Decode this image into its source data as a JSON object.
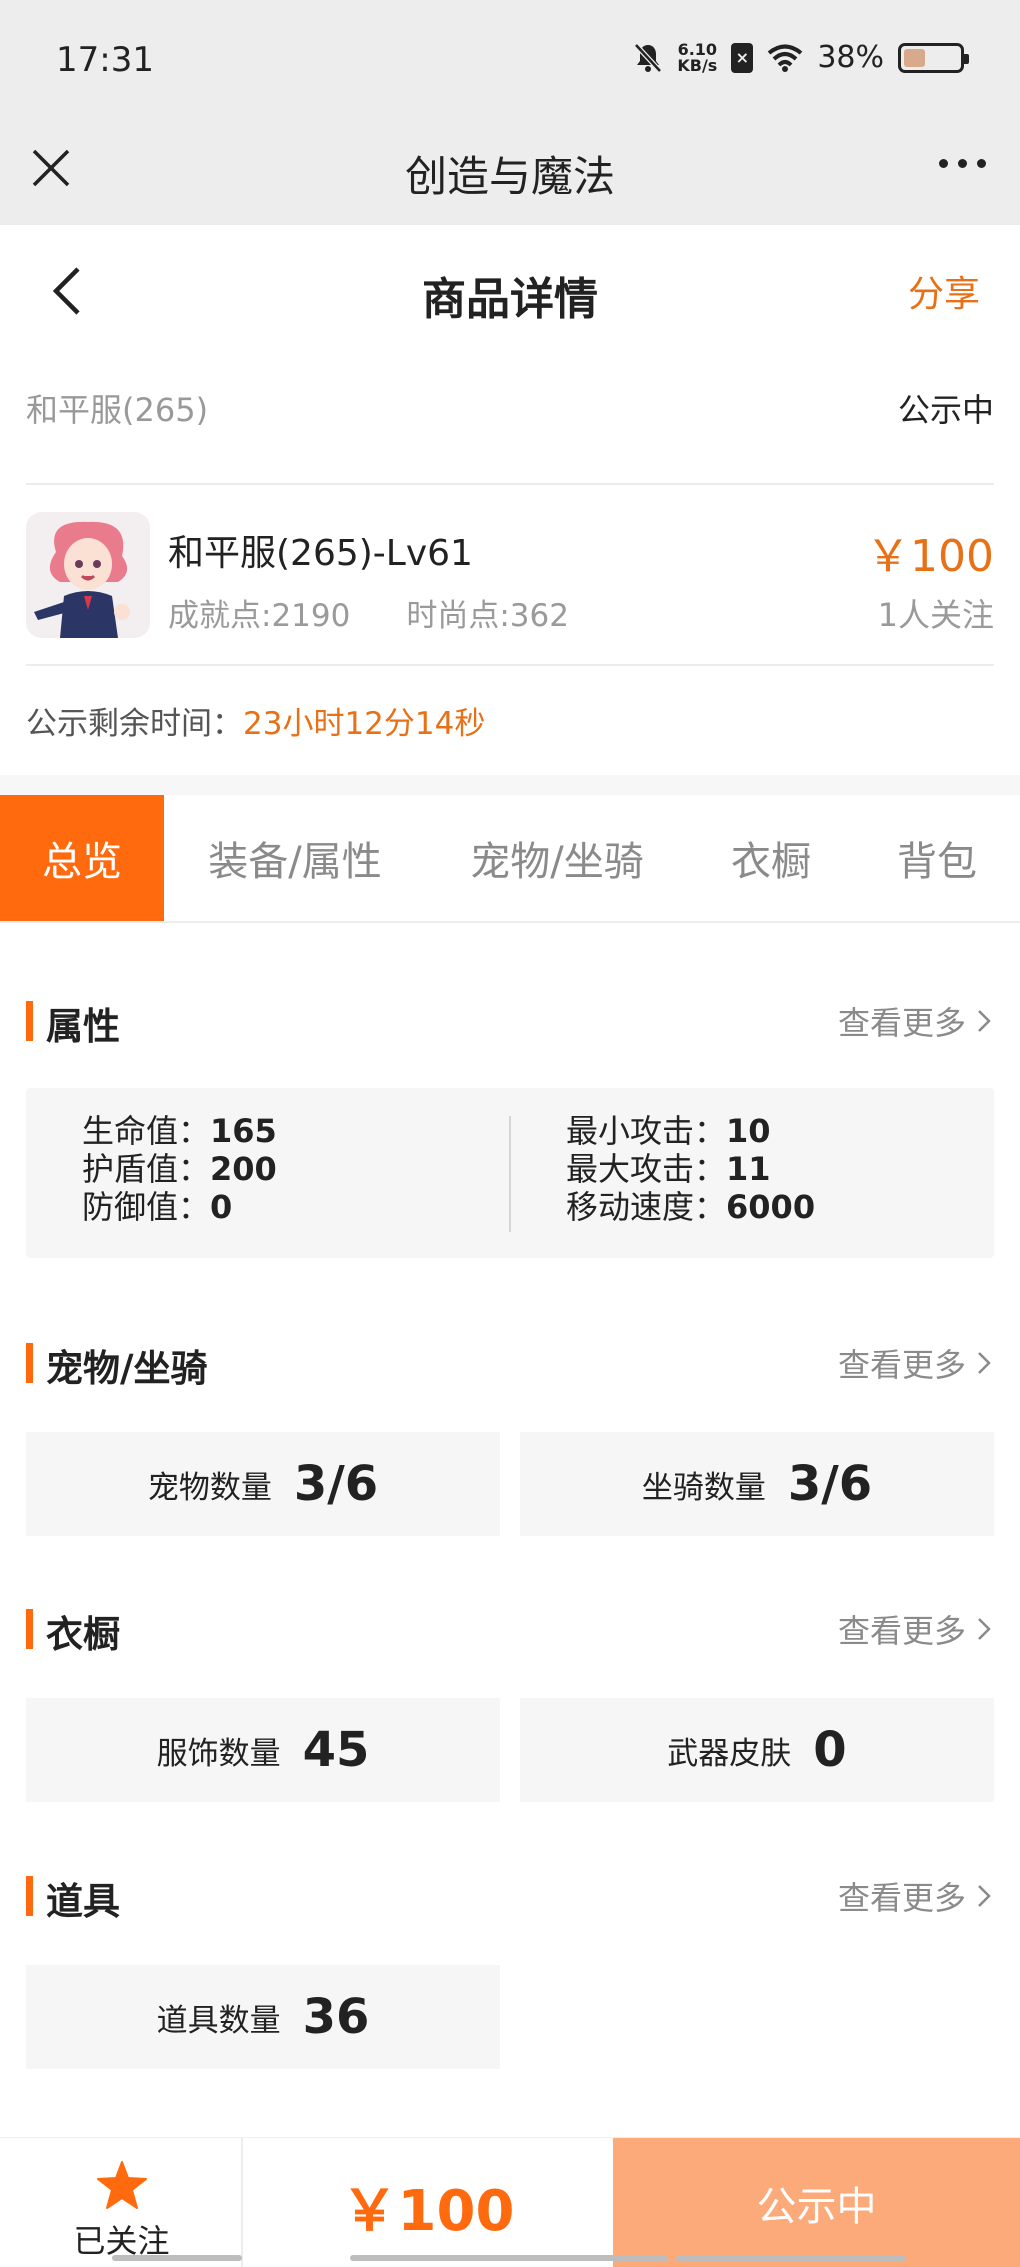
{
  "status_bar": {
    "time": "17:31",
    "net_speed_value": "6.10",
    "net_speed_unit": "KB/s",
    "battery": "38%",
    "battery_level": 0.38
  },
  "app_bar": {
    "title": "创造与魔法"
  },
  "header": {
    "title": "商品详情",
    "share_label": "分享"
  },
  "listing": {
    "server": "和平服(265)",
    "status": "公示中",
    "name": "和平服(265)-Lv61",
    "achievement": "成就点:2190",
    "fashion": "时尚点:362",
    "price": "￥100",
    "followers": "1人关注",
    "remain_label": "公示剩余时间：",
    "remain_value": "23小时12分14秒"
  },
  "tabs": [
    {
      "label": "总览",
      "active": true
    },
    {
      "label": "装备/属性",
      "active": false
    },
    {
      "label": "宠物/坐骑",
      "active": false
    },
    {
      "label": "衣橱",
      "active": false
    },
    {
      "label": "背包",
      "active": false
    }
  ],
  "more_label": "查看更多",
  "attributes": {
    "title": "属性",
    "left": [
      {
        "label": "生命值：",
        "value": "165"
      },
      {
        "label": "护盾值：",
        "value": "200"
      },
      {
        "label": "防御值：",
        "value": "0"
      }
    ],
    "right": [
      {
        "label": "最小攻击：",
        "value": "10"
      },
      {
        "label": "最大攻击：",
        "value": "11"
      },
      {
        "label": "移动速度：",
        "value": "6000"
      }
    ]
  },
  "pets": {
    "title": "宠物/坐骑",
    "cards": [
      {
        "label": "宠物数量",
        "value": "3/6"
      },
      {
        "label": "坐骑数量",
        "value": "3/6"
      }
    ]
  },
  "wardrobe": {
    "title": "衣橱",
    "cards": [
      {
        "label": "服饰数量",
        "value": "45"
      },
      {
        "label": "武器皮肤",
        "value": "0"
      }
    ]
  },
  "items": {
    "title": "道具",
    "cards": [
      {
        "label": "道具数量",
        "value": "36"
      }
    ]
  },
  "bottom_bar": {
    "follow_label": "已关注",
    "price": "￥100",
    "status_label": "公示中"
  },
  "colors": {
    "accent": "#ff6a0e",
    "accent_text": "#e87117",
    "status_button": "#fdaa7a"
  }
}
